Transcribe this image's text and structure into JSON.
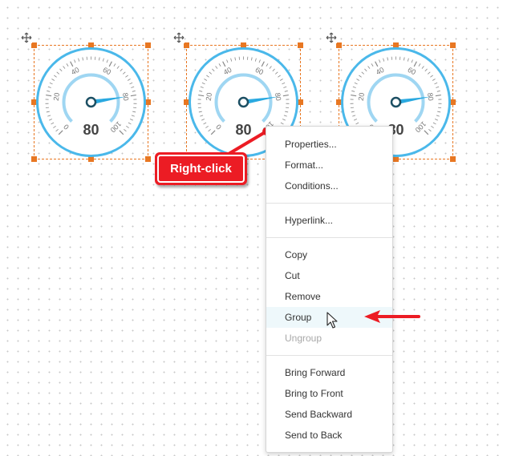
{
  "gauges": [
    {
      "value": "80",
      "ticks": [
        "0",
        "20",
        "40",
        "60",
        "80",
        "100"
      ],
      "needle_value": 80
    },
    {
      "value": "80",
      "ticks": [
        "0",
        "20",
        "40",
        "60",
        "80",
        "100"
      ],
      "needle_value": 80
    },
    {
      "value": "80",
      "ticks": [
        "0",
        "20",
        "40",
        "60",
        "80",
        "100"
      ],
      "needle_value": 80
    }
  ],
  "gauge_colors": {
    "rim": "#4ab8ea",
    "inner_arc": "#9fd6f2",
    "needle": "#2aa9e0",
    "hub": "#1c4f63",
    "selection": "#e87722"
  },
  "context_menu": {
    "sections": [
      {
        "items": [
          {
            "label": "Properties...",
            "enabled": true
          },
          {
            "label": "Format...",
            "enabled": true
          },
          {
            "label": "Conditions...",
            "enabled": true
          }
        ]
      },
      {
        "items": [
          {
            "label": "Hyperlink...",
            "enabled": true
          }
        ]
      },
      {
        "items": [
          {
            "label": "Copy",
            "enabled": true
          },
          {
            "label": "Cut",
            "enabled": true
          },
          {
            "label": "Remove",
            "enabled": true
          },
          {
            "label": "Group",
            "enabled": true,
            "hovered": true
          },
          {
            "label": "Ungroup",
            "enabled": false
          }
        ]
      },
      {
        "items": [
          {
            "label": "Bring Forward",
            "enabled": true
          },
          {
            "label": "Bring to Front",
            "enabled": true
          },
          {
            "label": "Send Backward",
            "enabled": true
          },
          {
            "label": "Send to Back",
            "enabled": true
          }
        ]
      }
    ]
  },
  "annotation": {
    "callout_text": "Right-click",
    "color": "#ec1c24"
  }
}
